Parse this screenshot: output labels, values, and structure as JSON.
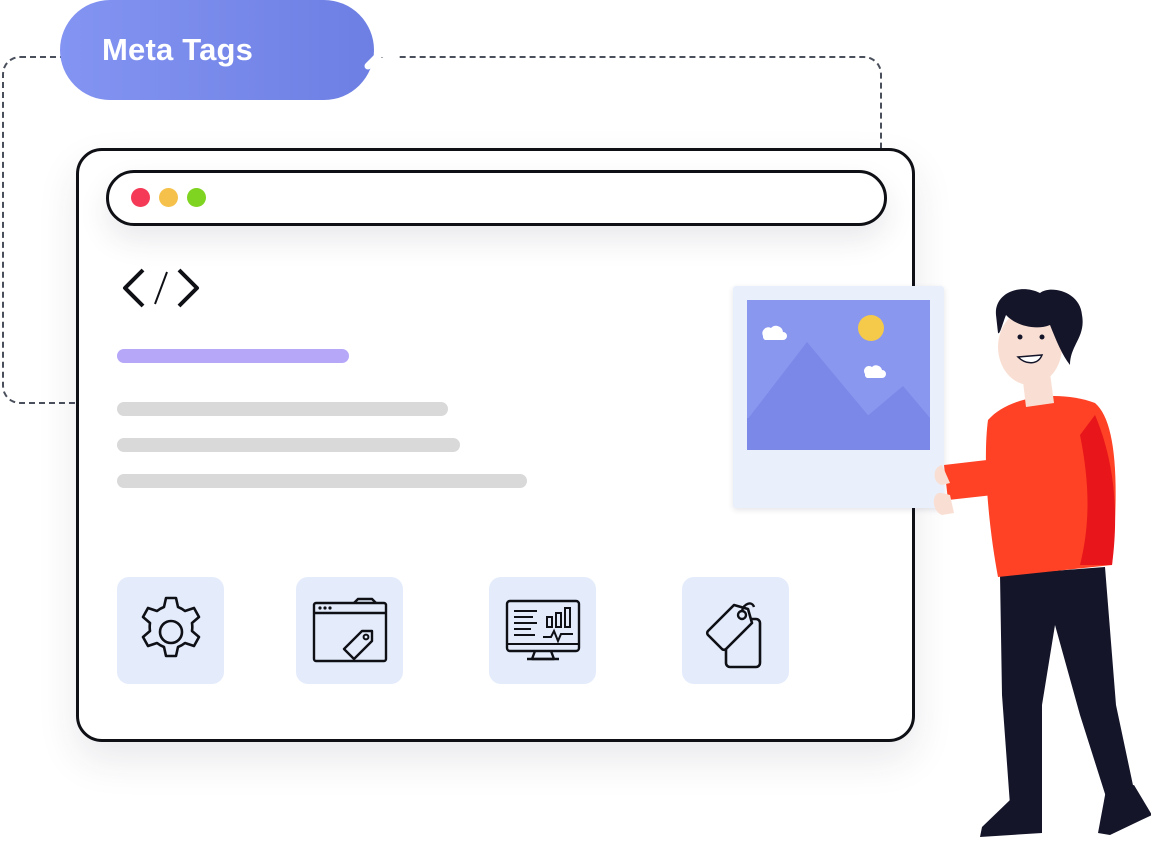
{
  "search_pill": {
    "label": "Meta Tags",
    "icon": "search-icon"
  },
  "browser": {
    "window_controls": [
      "close-dot",
      "minimize-dot",
      "maximize-dot"
    ],
    "code_icon": "code-icon",
    "feature_icons": [
      "gear-icon",
      "webpage-tag-icon",
      "analytics-monitor-icon",
      "price-tags-icon"
    ]
  },
  "colors": {
    "pill_gradient_start": "#8394f2",
    "pill_gradient_end": "#6d7fe3",
    "title_bar": "#b6a7f9",
    "text_bar": "#d9d9d9",
    "tile_bg": "#e4ecfc",
    "dot_red": "#f43a57",
    "dot_yellow": "#f5c14a",
    "dot_green": "#7fd321",
    "shirt": "#ff4225",
    "pants": "#15152a",
    "picture_sky": "#8a97ef"
  }
}
